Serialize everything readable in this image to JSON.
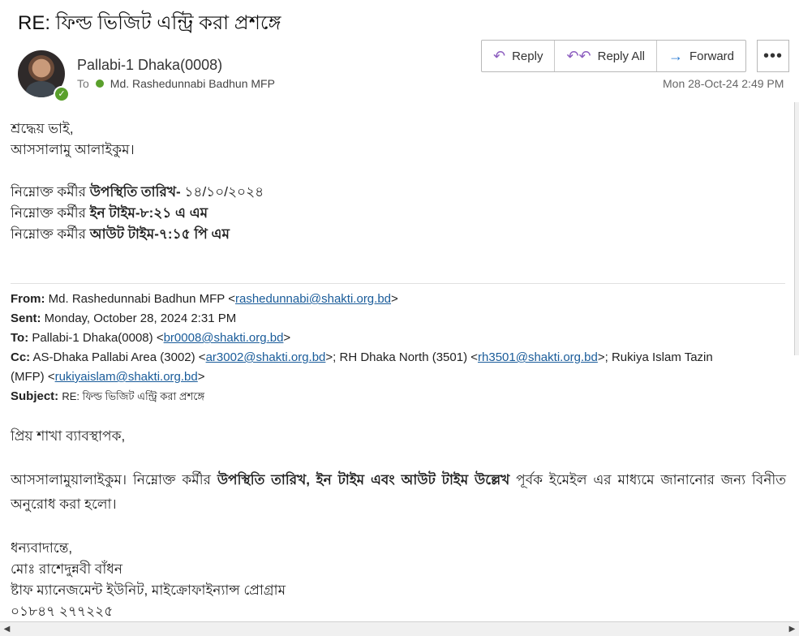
{
  "email": {
    "subject": "RE: ফিল্ড ভিজিট এন্ট্রি করা প্রশঙ্গে",
    "sender": "Pallabi-1 Dhaka(0008)",
    "to_label": "To",
    "to_name": "Md. Rashedunnabi Badhun MFP",
    "date": "Mon 28-Oct-24 2:49 PM"
  },
  "actions": {
    "reply": "Reply",
    "reply_all": "Reply All",
    "forward": "Forward",
    "more": "•••"
  },
  "body": {
    "greeting": "শ্রদ্ধেয় ভাই,",
    "salam": "আসসালামু আলাইকুম।",
    "line1_prefix": "নিম্নোক্ত কর্মীর",
    "line1_bold": "উপস্থিতি তারিখ-",
    "line1_value": "১৪/১০/২০২৪",
    "line2_prefix": "নিম্নোক্ত কর্মীর",
    "line2_bold": "ইন টাইম-৮:২১ এ এম",
    "line3_prefix": "নিম্নোক্ত কর্মীর",
    "line3_bold": "আউট টাইম-৭:১৫ পি এম"
  },
  "quoted_header": {
    "from_label": "From:",
    "from_name": "Md. Rashedunnabi Badhun MFP",
    "from_email": "rashedunnabi@shakti.org.bd",
    "sent_label": "Sent:",
    "sent_value": "Monday, October 28, 2024 2:31 PM",
    "to_label": "To:",
    "to_name": "Pallabi-1 Dhaka(0008)",
    "to_email": "br0008@shakti.org.bd",
    "cc_label": "Cc:",
    "cc1_name": "AS-Dhaka Pallabi Area (3002)",
    "cc1_email": "ar3002@shakti.org.bd",
    "cc2_name": "RH Dhaka North (3501)",
    "cc2_email": "rh3501@shakti.org.bd",
    "cc3_name_a": "Rukiya Islam Tazin",
    "cc3_name_b": "(MFP)",
    "cc3_email": "rukiyaislam@shakti.org.bd",
    "subject_label": "Subject:",
    "subject_value": "RE: ফিল্ড ভিজিট এন্ট্রি করা প্রশঙ্গে"
  },
  "quoted_body": {
    "salutation": "প্রিয় শাখা ব্যাবস্থাপক,",
    "para_start": "আসসালামুয়ালাইকুম। নিম্নোক্ত কর্মীর",
    "para_bold": "উপস্থিতি তারিখ, ইন টাইম এবং আউট টাইম উল্লেখ",
    "para_end": "পূর্বক ইমেইল এর মাধ্যমে জানানোর জন্য বিনীত অনুরোধ করা হলো।",
    "closing": "ধন্যবাদান্তে,",
    "sig_name": "মোঃ রাশেদুন্নবী বাঁধন",
    "sig_title": "ষ্টাফ ম্যানেজমেন্ট ইউনিট, মাইক্রোফাইন্যান্স প্রোগ্রাম",
    "sig_phone": "০১৮৪৭ ২৭৭২২৫"
  },
  "colors": {
    "link": "#1a5c9a",
    "presence": "#5aa02c",
    "reply_icon": "#8c5dbf",
    "forward_icon": "#2b7cd3"
  },
  "icons": [
    "reply-icon",
    "reply-all-icon",
    "forward-icon",
    "more-icon",
    "presence-check-icon"
  ]
}
